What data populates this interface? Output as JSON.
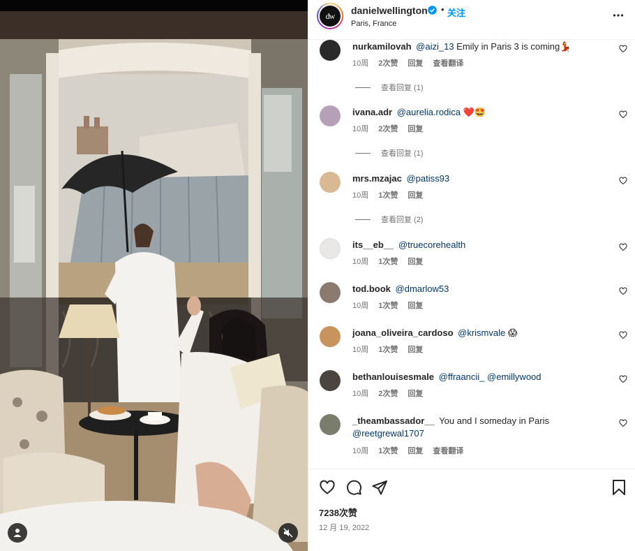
{
  "media": {
    "user_tag_icon": "user-silhouette-icon",
    "mute_icon": "speaker-muted-icon"
  },
  "header": {
    "avatar_text": "dw",
    "username": "danielwellington",
    "verified_icon": "verified-badge-icon",
    "separator": "•",
    "follow_label": "关注",
    "location": "Paris, France",
    "more_icon": "more-dots-icon"
  },
  "comments": [
    {
      "user": "nurkamilovah",
      "mentions": [
        "@aizi_13"
      ],
      "text": " Emily in Paris 3 is coming💃",
      "age": "10周",
      "likes": "2次赞",
      "reply": "回复",
      "translate": "查看翻译",
      "view_replies": "查看回复 (1)",
      "avatar_color": "#2a2a2a"
    },
    {
      "user": "ivana.adr",
      "mentions": [
        "@aurelia.rodica"
      ],
      "text": " ❤️🤩",
      "age": "10周",
      "likes": "2次赞",
      "reply": "回复",
      "translate": "",
      "view_replies": "查看回复 (1)",
      "avatar_color": "#b5a0b8"
    },
    {
      "user": "mrs.mzajac",
      "mentions": [
        "@patiss93"
      ],
      "text": "",
      "age": "10周",
      "likes": "1次赞",
      "reply": "回复",
      "translate": "",
      "view_replies": "查看回复 (2)",
      "avatar_color": "#d9b993"
    },
    {
      "user": "its__eb__",
      "mentions": [
        "@truecorehealth"
      ],
      "text": "",
      "age": "10周",
      "likes": "1次赞",
      "reply": "回复",
      "translate": "",
      "view_replies": "",
      "avatar_color": "#e9e6e6"
    },
    {
      "user": "tod.book",
      "mentions": [
        "@dmarlow53"
      ],
      "text": "",
      "age": "10周",
      "likes": "1次赞",
      "reply": "回复",
      "translate": "",
      "view_replies": "",
      "avatar_color": "#8a7a70"
    },
    {
      "user": "joana_oliveira_cardoso",
      "mentions": [
        "@krismvale"
      ],
      "text": " 😱",
      "age": "10周",
      "likes": "1次赞",
      "reply": "回复",
      "translate": "",
      "view_replies": "",
      "avatar_color": "#c9935e"
    },
    {
      "user": "bethanlouisesmale",
      "mentions": [
        "@ffraancii_",
        "@emillywood"
      ],
      "text": "",
      "age": "10周",
      "likes": "2次赞",
      "reply": "回复",
      "translate": "",
      "view_replies": "",
      "avatar_color": "#4b4540"
    },
    {
      "user": "_theambassador__",
      "mentions": [],
      "text": "You and I someday in Paris",
      "mention_after": "@reetgrewal1707",
      "age": "10周",
      "likes": "1次赞",
      "reply": "回复",
      "translate": "查看翻译",
      "view_replies": "",
      "avatar_color": "#7b7d6c"
    }
  ],
  "actions": {
    "like_icon": "heart-icon",
    "comment_icon": "comment-bubble-icon",
    "share_icon": "paper-plane-icon",
    "save_icon": "bookmark-icon",
    "likes_count": "7238次赞",
    "date": "12 月 19, 2022"
  }
}
